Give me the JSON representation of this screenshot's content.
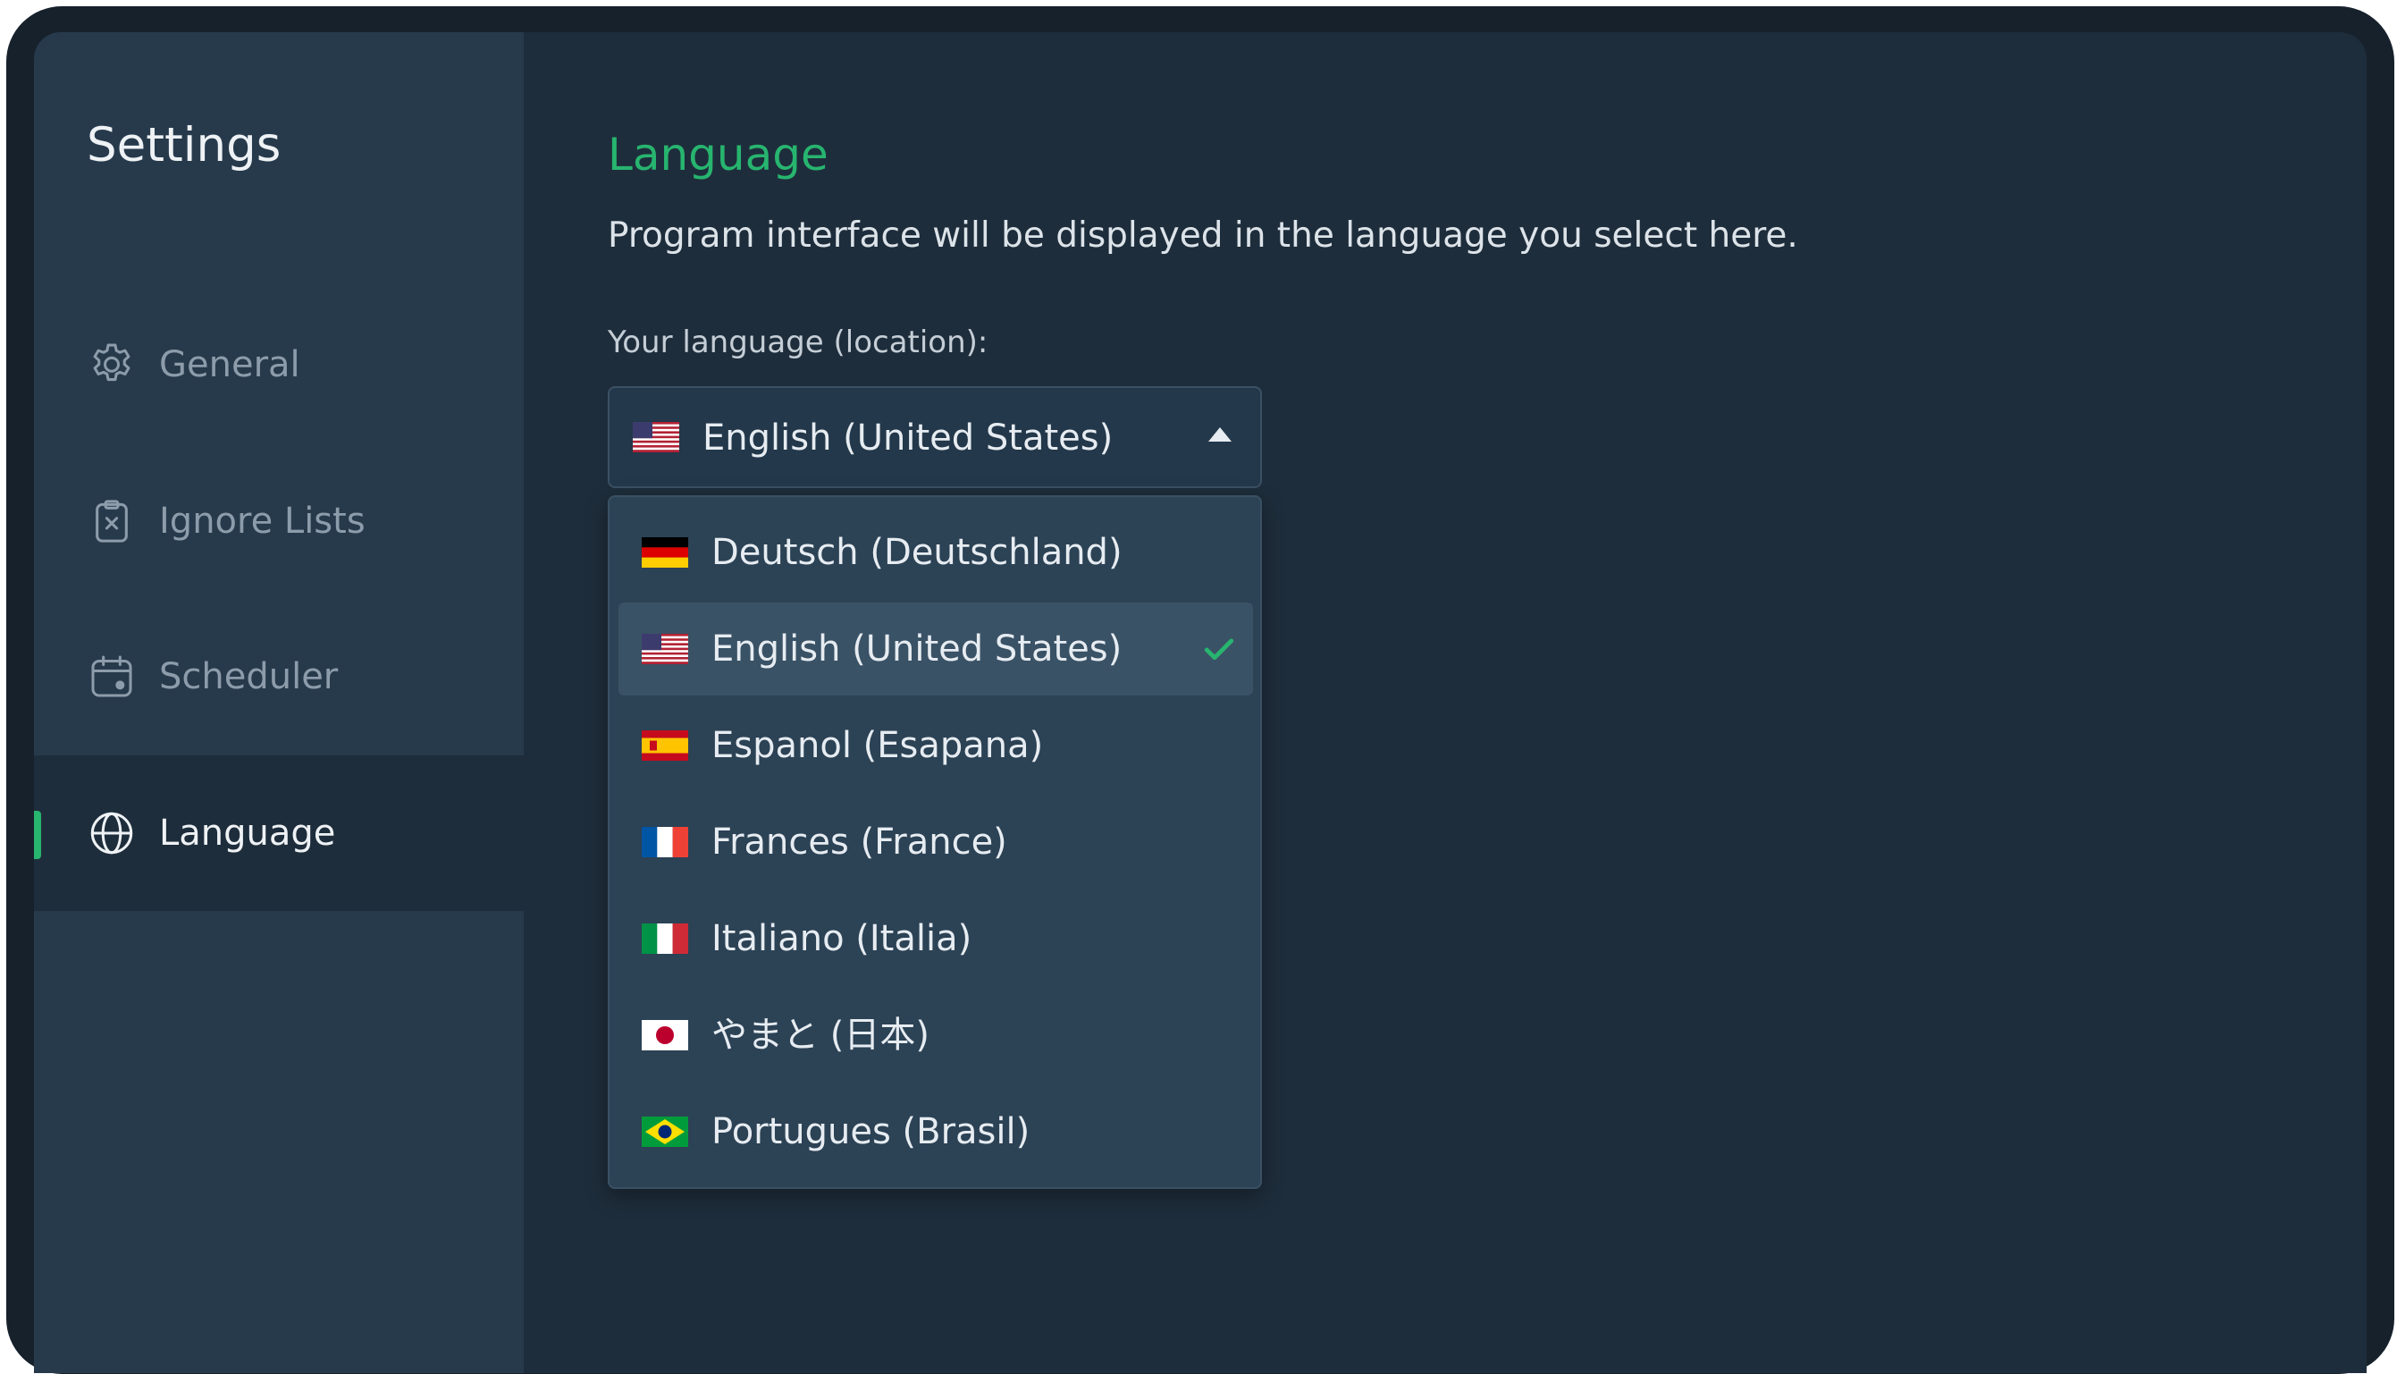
{
  "sidebar": {
    "title": "Settings",
    "items": [
      {
        "label": "General",
        "icon": "gear-icon"
      },
      {
        "label": "Ignore Lists",
        "icon": "clipboard-x-icon"
      },
      {
        "label": "Scheduler",
        "icon": "calendar-icon"
      },
      {
        "label": "Language",
        "icon": "globe-icon",
        "active": true
      }
    ]
  },
  "main": {
    "title": "Language",
    "description": "Program interface will be displayed in the language you select here.",
    "field_label": "Your language (location):",
    "select": {
      "value": "English (United States)",
      "flag": "us-flag-icon",
      "expanded": true
    },
    "options": [
      {
        "label": "Deutsch (Deutschland)",
        "flag": "germany-flag-icon"
      },
      {
        "label": "English (United States)",
        "flag": "us-flag-icon",
        "selected": true
      },
      {
        "label": "Espanol (Esapana)",
        "flag": "spain-flag-icon"
      },
      {
        "label": "Frances (France)",
        "flag": "france-flag-icon"
      },
      {
        "label": "Italiano (Italia)",
        "flag": "italy-flag-icon"
      },
      {
        "label": "やまと (日本)",
        "flag": "japan-flag-icon"
      },
      {
        "label": "Portugues (Brasil)",
        "flag": "brazil-flag-icon"
      }
    ]
  },
  "colors": {
    "accent": "#27b56f",
    "window_bg": "#1e2d3b",
    "sidebar_bg": "#273a4c",
    "dropdown_bg": "#2c4255",
    "selected_option_bg": "#3a5266"
  }
}
